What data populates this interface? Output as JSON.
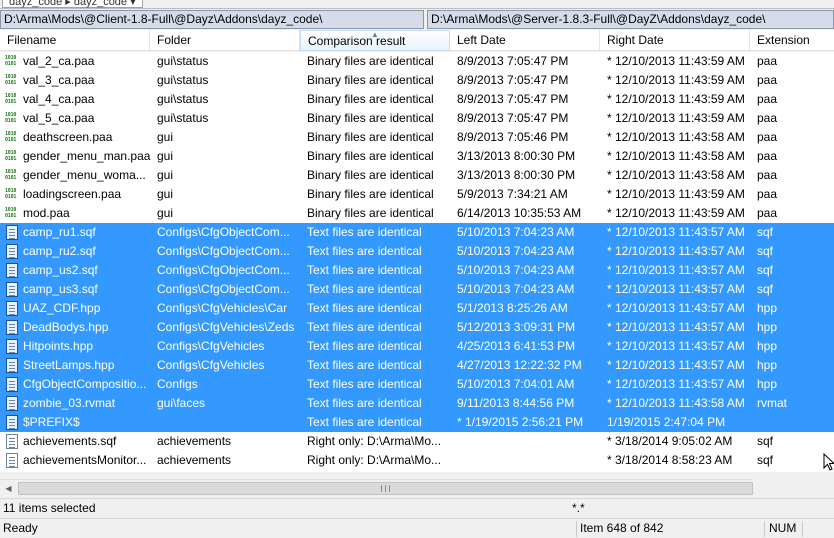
{
  "tab": {
    "label": "dayz_code ▸ dayz_code ▾"
  },
  "paths": {
    "left": "D:\\Arma\\Mods\\@Client-1.8-Full\\@Dayz\\Addons\\dayz_code\\",
    "right": "D:\\Arma\\Mods\\@Server-1.8.3-Full\\@DayZ\\Addons\\dayz_code\\"
  },
  "columns": [
    "Filename",
    "Folder",
    "Comparison result",
    "Left Date",
    "Right Date",
    "Extension"
  ],
  "rows": [
    {
      "icon": "binary-file-icon",
      "name": "val_2_ca.paa",
      "folder": "gui\\status",
      "result": "Binary files are identical",
      "left": "8/9/2013 7:05:47 PM",
      "right": "* 12/10/2013 11:43:59 AM",
      "ext": "paa",
      "selected": false
    },
    {
      "icon": "binary-file-icon",
      "name": "val_3_ca.paa",
      "folder": "gui\\status",
      "result": "Binary files are identical",
      "left": "8/9/2013 7:05:47 PM",
      "right": "* 12/10/2013 11:43:59 AM",
      "ext": "paa",
      "selected": false
    },
    {
      "icon": "binary-file-icon",
      "name": "val_4_ca.paa",
      "folder": "gui\\status",
      "result": "Binary files are identical",
      "left": "8/9/2013 7:05:47 PM",
      "right": "* 12/10/2013 11:43:59 AM",
      "ext": "paa",
      "selected": false
    },
    {
      "icon": "binary-file-icon",
      "name": "val_5_ca.paa",
      "folder": "gui\\status",
      "result": "Binary files are identical",
      "left": "8/9/2013 7:05:47 PM",
      "right": "* 12/10/2013 11:43:59 AM",
      "ext": "paa",
      "selected": false
    },
    {
      "icon": "binary-file-icon",
      "name": "deathscreen.paa",
      "folder": "gui",
      "result": "Binary files are identical",
      "left": "8/9/2013 7:05:46 PM",
      "right": "* 12/10/2013 11:43:58 AM",
      "ext": "paa",
      "selected": false
    },
    {
      "icon": "binary-file-icon",
      "name": "gender_menu_man.paa",
      "folder": "gui",
      "result": "Binary files are identical",
      "left": "3/13/2013 8:00:30 PM",
      "right": "* 12/10/2013 11:43:58 AM",
      "ext": "paa",
      "selected": false
    },
    {
      "icon": "binary-file-icon",
      "name": "gender_menu_woma...",
      "folder": "gui",
      "result": "Binary files are identical",
      "left": "3/13/2013 8:00:30 PM",
      "right": "* 12/10/2013 11:43:58 AM",
      "ext": "paa",
      "selected": false
    },
    {
      "icon": "binary-file-icon",
      "name": "loadingscreen.paa",
      "folder": "gui",
      "result": "Binary files are identical",
      "left": "5/9/2013 7:34:21 AM",
      "right": "* 12/10/2013 11:43:59 AM",
      "ext": "paa",
      "selected": false
    },
    {
      "icon": "binary-file-icon",
      "name": "mod.paa",
      "folder": "gui",
      "result": "Binary files are identical",
      "left": "6/14/2013 10:35:53 AM",
      "right": "* 12/10/2013 11:43:59 AM",
      "ext": "paa",
      "selected": false
    },
    {
      "icon": "text-file-icon",
      "name": "camp_ru1.sqf",
      "folder": "Configs\\CfgObjectCom...",
      "result": "Text files are identical",
      "left": "5/10/2013 7:04:23 AM",
      "right": "* 12/10/2013 11:43:57 AM",
      "ext": "sqf",
      "selected": true
    },
    {
      "icon": "text-file-icon",
      "name": "camp_ru2.sqf",
      "folder": "Configs\\CfgObjectCom...",
      "result": "Text files are identical",
      "left": "5/10/2013 7:04:23 AM",
      "right": "* 12/10/2013 11:43:57 AM",
      "ext": "sqf",
      "selected": true
    },
    {
      "icon": "text-file-icon",
      "name": "camp_us2.sqf",
      "folder": "Configs\\CfgObjectCom...",
      "result": "Text files are identical",
      "left": "5/10/2013 7:04:23 AM",
      "right": "* 12/10/2013 11:43:57 AM",
      "ext": "sqf",
      "selected": true
    },
    {
      "icon": "text-file-icon",
      "name": "camp_us3.sqf",
      "folder": "Configs\\CfgObjectCom...",
      "result": "Text files are identical",
      "left": "5/10/2013 7:04:23 AM",
      "right": "* 12/10/2013 11:43:57 AM",
      "ext": "sqf",
      "selected": true
    },
    {
      "icon": "text-file-icon",
      "name": "UAZ_CDF.hpp",
      "folder": "Configs\\CfgVehicles\\Car",
      "result": "Text files are identical",
      "left": "5/1/2013 8:25:26 AM",
      "right": "* 12/10/2013 11:43:57 AM",
      "ext": "hpp",
      "selected": true
    },
    {
      "icon": "text-file-icon",
      "name": "DeadBodys.hpp",
      "folder": "Configs\\CfgVehicles\\Zeds",
      "result": "Text files are identical",
      "left": "5/12/2013 3:09:31 PM",
      "right": "* 12/10/2013 11:43:57 AM",
      "ext": "hpp",
      "selected": true
    },
    {
      "icon": "text-file-icon",
      "name": "Hitpoints.hpp",
      "folder": "Configs\\CfgVehicles",
      "result": "Text files are identical",
      "left": "4/25/2013 6:41:53 PM",
      "right": "* 12/10/2013 11:43:57 AM",
      "ext": "hpp",
      "selected": true
    },
    {
      "icon": "text-file-icon",
      "name": "StreetLamps.hpp",
      "folder": "Configs\\CfgVehicles",
      "result": "Text files are identical",
      "left": "4/27/2013 12:22:32 PM",
      "right": "* 12/10/2013 11:43:57 AM",
      "ext": "hpp",
      "selected": true
    },
    {
      "icon": "text-file-icon",
      "name": "CfgObjectCompositio...",
      "folder": "Configs",
      "result": "Text files are identical",
      "left": "5/10/2013 7:04:01 AM",
      "right": "* 12/10/2013 11:43:57 AM",
      "ext": "hpp",
      "selected": true
    },
    {
      "icon": "text-file-icon",
      "name": "zombie_03.rvmat",
      "folder": "gui\\faces",
      "result": "Text files are identical",
      "left": "9/11/2013 8:44:56 PM",
      "right": "* 12/10/2013 11:43:58 AM",
      "ext": "rvmat",
      "selected": true
    },
    {
      "icon": "text-file-icon",
      "name": "$PREFIX$",
      "folder": "",
      "result": "Text files are identical",
      "left": "* 1/19/2015 2:56:21 PM",
      "right": "1/19/2015 2:47:04 PM",
      "ext": "",
      "selected": true
    },
    {
      "icon": "text-file-icon",
      "name": "achievements.sqf",
      "folder": "achievements",
      "result": "Right only: D:\\Arma\\Mo...",
      "left": "",
      "right": "* 3/18/2014 9:05:02 AM",
      "ext": "sqf",
      "selected": false
    },
    {
      "icon": "text-file-icon",
      "name": "achievementsMonitor...",
      "folder": "achievements",
      "result": "Right only: D:\\Arma\\Mo...",
      "left": "",
      "right": "* 3/18/2014 8:58:23 AM",
      "ext": "sqf",
      "selected": false
    }
  ],
  "status": {
    "selection": "11 items selected",
    "filter": "*.*",
    "ready": "Ready",
    "item_position": "Item 648 of 842",
    "num_lock": "NUM"
  }
}
